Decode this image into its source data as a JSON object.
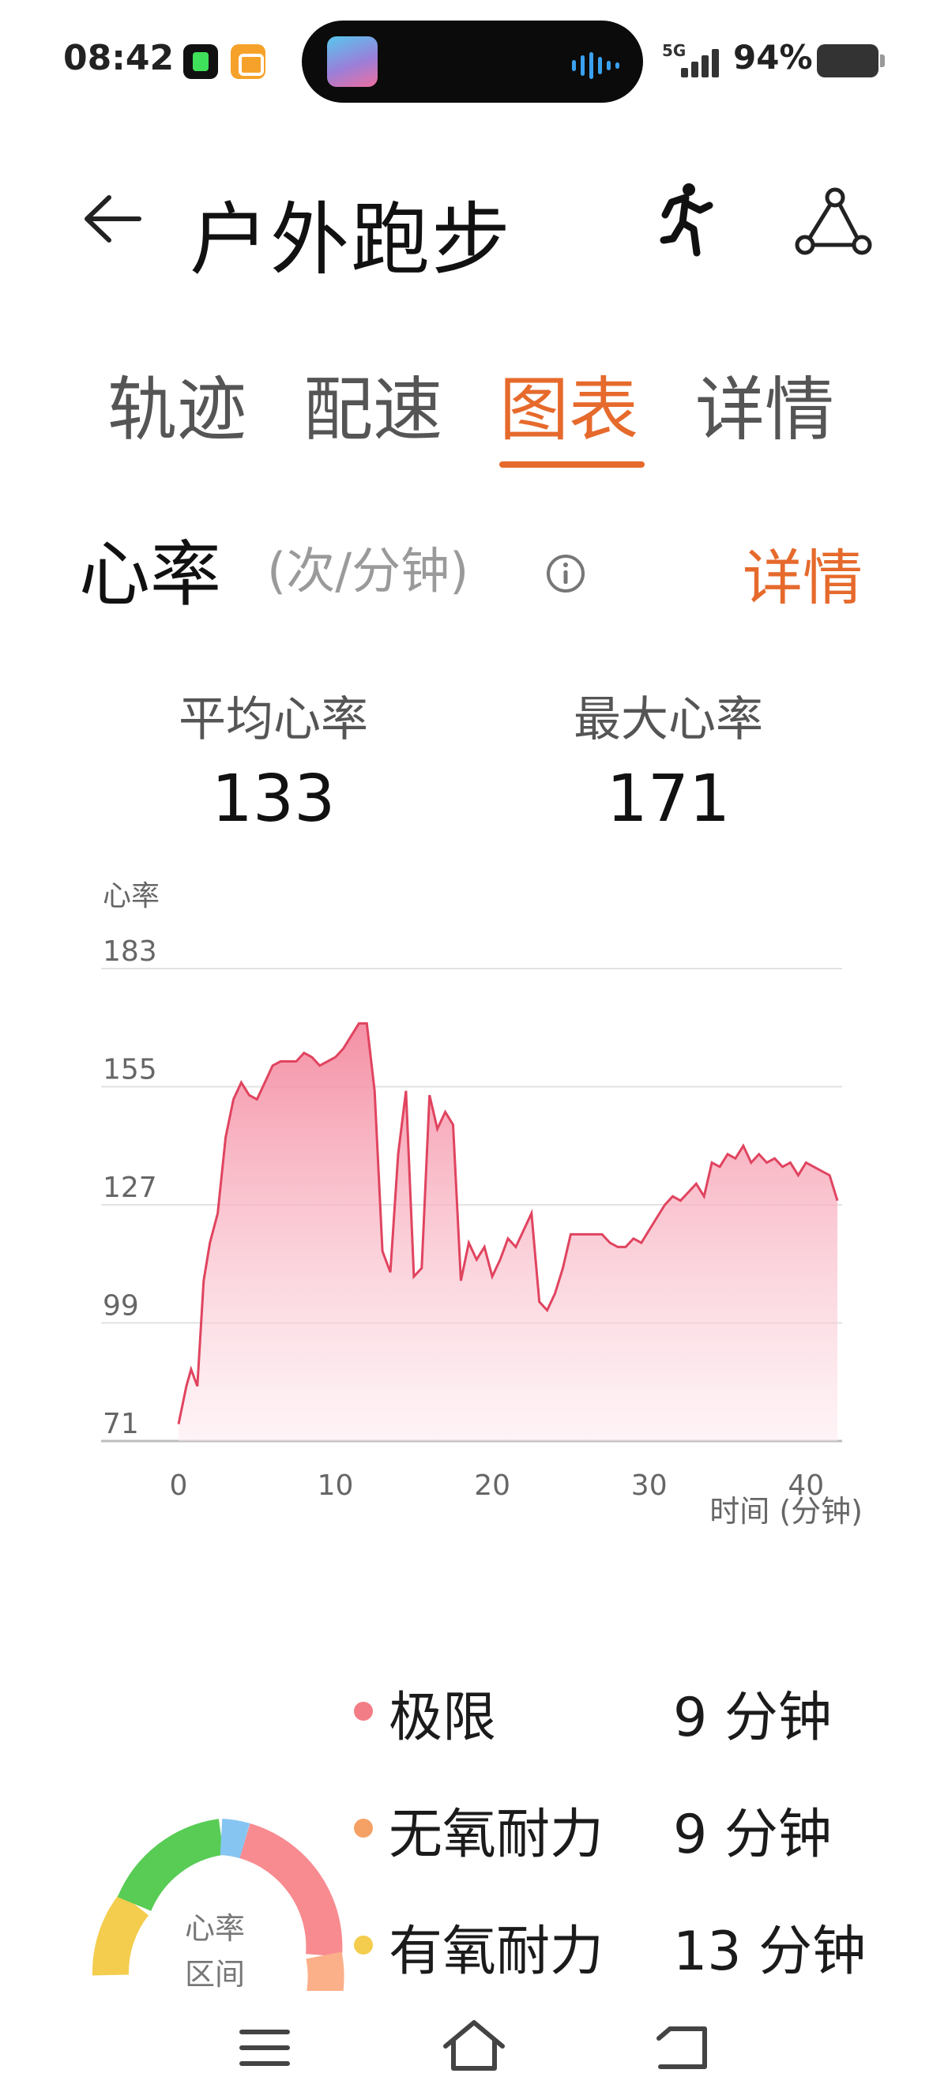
{
  "status_bar": {
    "time": "08:42",
    "network": "5G",
    "battery": "94%"
  },
  "header": {
    "title": "户外跑步",
    "icons": [
      "back-arrow-icon",
      "runner-icon",
      "share-route-icon"
    ]
  },
  "tabs": [
    {
      "label": "轨迹",
      "active": false
    },
    {
      "label": "配速",
      "active": false
    },
    {
      "label": "图表",
      "active": true
    },
    {
      "label": "详情",
      "active": false
    }
  ],
  "heart_rate": {
    "title": "心率",
    "unit": "(次/分钟)",
    "detail_link": "详情",
    "stats": [
      {
        "label": "平均心率",
        "value": "133"
      },
      {
        "label": "最大心率",
        "value": "171"
      }
    ]
  },
  "chart_data": {
    "type": "area",
    "title": "",
    "ylabel": "心率",
    "xlabel": "时间 (分钟)",
    "xlim": [
      0,
      42
    ],
    "ylim": [
      71,
      183
    ],
    "y_ticks": [
      183,
      155,
      127,
      99,
      71
    ],
    "x_ticks": [
      0,
      10,
      20,
      30,
      40
    ],
    "grid": true,
    "accent_color": "#e0445f",
    "series": [
      {
        "x": [
          0,
          0.5,
          0.8,
          1.2,
          1.6,
          2,
          2.5,
          3,
          3.5,
          4,
          4.5,
          5,
          5.5,
          6,
          6.5,
          7,
          7.5,
          8,
          8.5,
          9,
          9.5,
          10,
          10.5,
          11,
          11.5,
          12,
          12.5,
          13,
          13.5,
          14,
          14.5,
          15,
          15.5,
          16,
          16.5,
          17,
          17.5,
          18,
          18.5,
          19,
          19.5,
          20,
          20.5,
          21,
          21.5,
          22,
          22.5,
          23,
          23.5,
          24,
          24.5,
          25,
          25.5,
          26,
          26.5,
          27,
          27.5,
          28,
          28.5,
          29,
          29.5,
          30,
          30.5,
          31,
          31.5,
          32,
          32.5,
          33,
          33.5,
          34,
          34.5,
          35,
          35.5,
          36,
          36.5,
          37,
          37.5,
          38,
          38.5,
          39,
          39.5,
          40,
          40.5,
          41,
          41.5,
          42
        ],
        "values": [
          75,
          84,
          88,
          84,
          109,
          118,
          125,
          143,
          152,
          156,
          153,
          152,
          156,
          160,
          161,
          161,
          161,
          163,
          162,
          160,
          161,
          162,
          164,
          167,
          170,
          170,
          154,
          116,
          111,
          139,
          154,
          110,
          112,
          153,
          145,
          149,
          146,
          109,
          118,
          114,
          117,
          110,
          114,
          119,
          117,
          121,
          125,
          104,
          102,
          106,
          112,
          120,
          120,
          120,
          120,
          120,
          118,
          117,
          117,
          119,
          118,
          121,
          124,
          127,
          129,
          128,
          130,
          132,
          129,
          137,
          136,
          139,
          138,
          141,
          137,
          139,
          137,
          138,
          136,
          137,
          134,
          137,
          136,
          135,
          134,
          128
        ]
      }
    ]
  },
  "zones": {
    "center_label_line1": "心率",
    "center_label_line2": "区间",
    "items": [
      {
        "name": "极限",
        "time": "9 分钟",
        "color": "#f27d86"
      },
      {
        "name": "无氧耐力",
        "time": "9 分钟",
        "color": "#f5a166"
      },
      {
        "name": "有氧耐力",
        "time": "13 分钟",
        "color": "#f4cd4e"
      }
    ]
  },
  "nav": {
    "icons": [
      "menu-icon",
      "home-icon",
      "back-icon"
    ]
  }
}
